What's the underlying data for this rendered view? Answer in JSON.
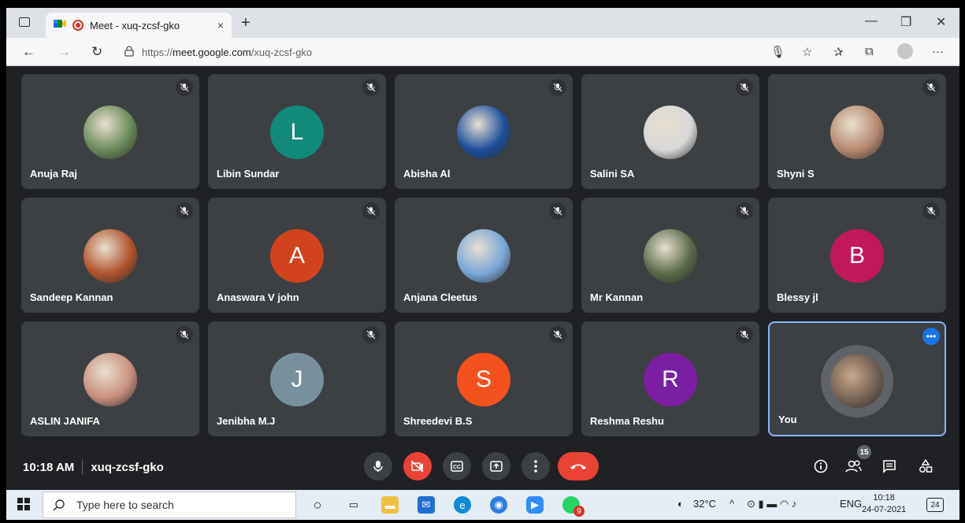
{
  "browser": {
    "tab_title": "Meet - xuq-zcsf-gko",
    "new_tab": "+",
    "close_tab": "×",
    "url_prefix": "https://",
    "url_host": "meet.google.com",
    "url_path": "/xuq-zcsf-gko",
    "minimize": "—",
    "restore": "❐",
    "close": "✕",
    "more": "···"
  },
  "participants": [
    {
      "name": "Anuja Raj",
      "avatar": "photo",
      "color": "#6a8a5a"
    },
    {
      "name": "Libin Sundar",
      "avatar": "L",
      "color": "#128a7a"
    },
    {
      "name": "Abisha Al",
      "avatar": "photo",
      "color": "#1b4e9a"
    },
    {
      "name": "Salini SA",
      "avatar": "photo",
      "color": "#d8d8d8"
    },
    {
      "name": "Shyni S",
      "avatar": "photo",
      "color": "#b58a70"
    },
    {
      "name": "Sandeep Kannan",
      "avatar": "photo",
      "color": "#b0542c"
    },
    {
      "name": "Anaswara V john",
      "avatar": "A",
      "color": "#d2421c"
    },
    {
      "name": "Anjana Cleetus",
      "avatar": "photo",
      "color": "#7aa6d6"
    },
    {
      "name": "Mr Kannan",
      "avatar": "photo",
      "color": "#5a6a4a"
    },
    {
      "name": "Blessy jl",
      "avatar": "B",
      "color": "#c2185b"
    },
    {
      "name": "ASLIN JANIFA",
      "avatar": "photo",
      "color": "#c89080"
    },
    {
      "name": "Jenibha M.J",
      "avatar": "J",
      "color": "#78909c"
    },
    {
      "name": "Shreedevi B.S",
      "avatar": "S",
      "color": "#f4511e"
    },
    {
      "name": "Reshma Reshu",
      "avatar": "R",
      "color": "#7b1fa2"
    },
    {
      "name": "You",
      "avatar": "photo",
      "color": "#6a5a50"
    }
  ],
  "meeting": {
    "time": "10:18 AM",
    "code": "xuq-zcsf-gko",
    "people_count": "15"
  },
  "taskbar": {
    "search_placeholder": "Type here to search",
    "weather": "32°C",
    "lang": "ENG",
    "time": "10:18",
    "date": "24-07-2021",
    "notif_count": "24",
    "whatsapp_badge": "9"
  }
}
